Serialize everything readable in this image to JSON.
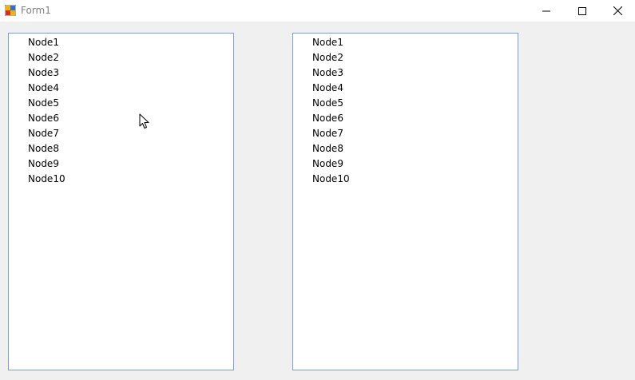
{
  "window": {
    "title": "Form1"
  },
  "caption_buttons": {
    "minimize_icon": "minimize-icon",
    "maximize_icon": "maximize-icon",
    "close_icon": "close-icon"
  },
  "colors": {
    "tree_border": "#7a9cd3",
    "background": "#f0f0f0",
    "title_text": "#808080"
  },
  "tree_left": {
    "nodes": [
      "Node1",
      "Node2",
      "Node3",
      "Node4",
      "Node5",
      "Node6",
      "Node7",
      "Node8",
      "Node9",
      "Node10"
    ]
  },
  "tree_right": {
    "nodes": [
      "Node1",
      "Node2",
      "Node3",
      "Node4",
      "Node5",
      "Node6",
      "Node7",
      "Node8",
      "Node9",
      "Node10"
    ]
  }
}
